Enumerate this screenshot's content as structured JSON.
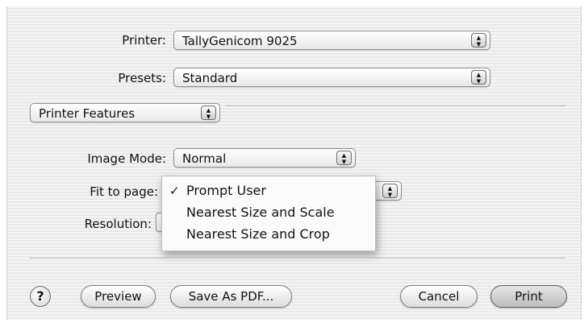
{
  "printer": {
    "label": "Printer:",
    "value": "TallyGenicom 9025"
  },
  "presets": {
    "label": "Presets:",
    "value": "Standard"
  },
  "panel": {
    "value": "Printer Features"
  },
  "image_mode": {
    "label": "Image Mode:",
    "value": "Normal"
  },
  "fit_to_page": {
    "label": "Fit to page:",
    "options": [
      "Prompt User",
      "Nearest Size and Scale",
      "Nearest Size and Crop"
    ],
    "selected": "Prompt User",
    "check_mark": "✓"
  },
  "resolution": {
    "label": "Resolution:"
  },
  "buttons": {
    "help": "?",
    "preview": "Preview",
    "save_pdf": "Save As PDF...",
    "cancel": "Cancel",
    "print": "Print"
  },
  "icons": {
    "popup_arrows": "updown-arrows-icon"
  }
}
